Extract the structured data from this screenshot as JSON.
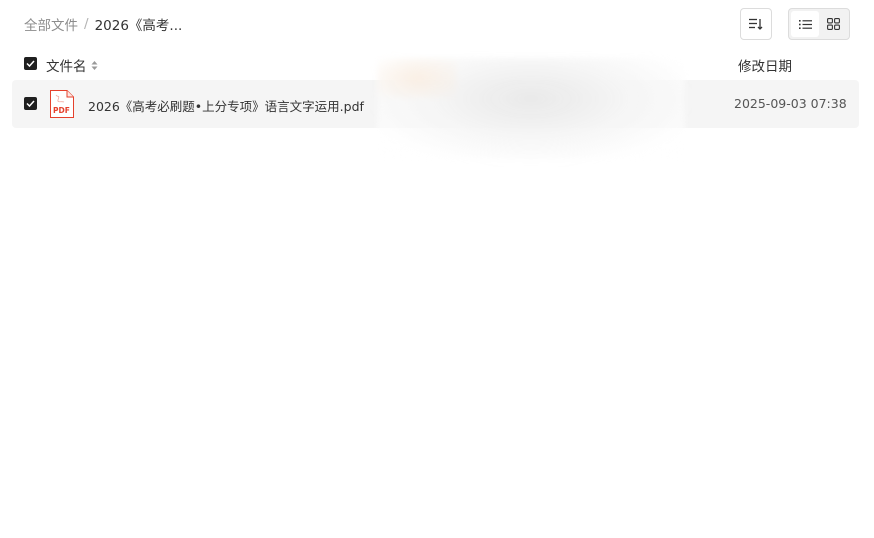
{
  "breadcrumb": {
    "root": "全部文件",
    "separator": "/",
    "current": "2026《高考..."
  },
  "toolbar": {
    "sort_icon": "sort-list-icon",
    "view_list_icon": "list-view-icon",
    "view_grid_icon": "grid-view-icon",
    "active_view": "list"
  },
  "table": {
    "headers": {
      "name": "文件名",
      "date": "修改日期"
    },
    "rows": [
      {
        "name": "2026《高考必刷题•上分专项》语言文字运用.pdf",
        "date": "2025-09-03 07:38",
        "type": "PDF",
        "selected": true
      }
    ]
  },
  "colors": {
    "checkbox": "#1f1f1f",
    "pdf_red": "#e5412d",
    "row_bg": "#f5f5f5"
  }
}
